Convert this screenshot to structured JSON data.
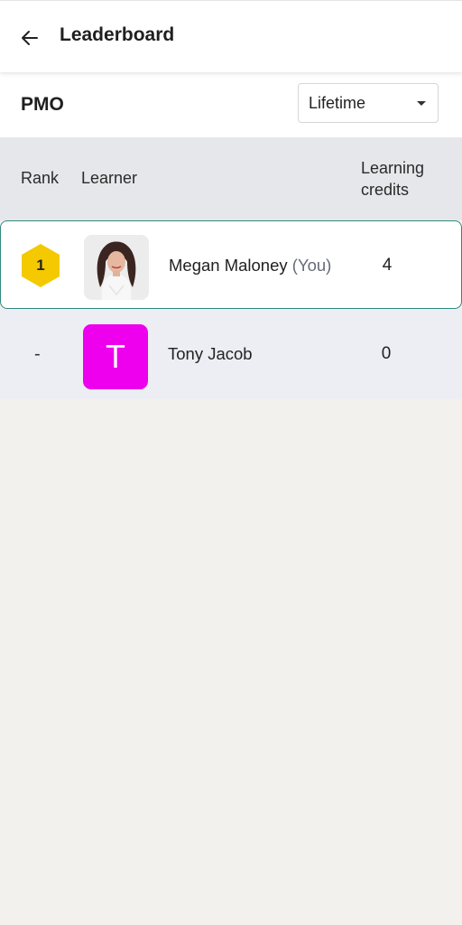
{
  "header": {
    "title": "Leaderboard",
    "back_icon": "arrow-left-icon"
  },
  "filter": {
    "group": "PMO",
    "period": "Lifetime"
  },
  "table": {
    "columns": {
      "rank": "Rank",
      "learner": "Learner",
      "credits": "Learning credits"
    },
    "rows": [
      {
        "rank": "1",
        "name": "Megan Maloney",
        "you_tag": "(You)",
        "credits": "4",
        "avatar": "photo",
        "highlighted": true
      },
      {
        "rank": "-",
        "name": "Tony Jacob",
        "initial": "T",
        "credits": "0",
        "avatar": "initial",
        "avatar_color": "#ee00ee"
      }
    ]
  },
  "colors": {
    "badge": "#f4c900",
    "highlight_border": "#2f8a82",
    "header_bg": "#e6e7ea",
    "background": "#f2f1ee"
  }
}
